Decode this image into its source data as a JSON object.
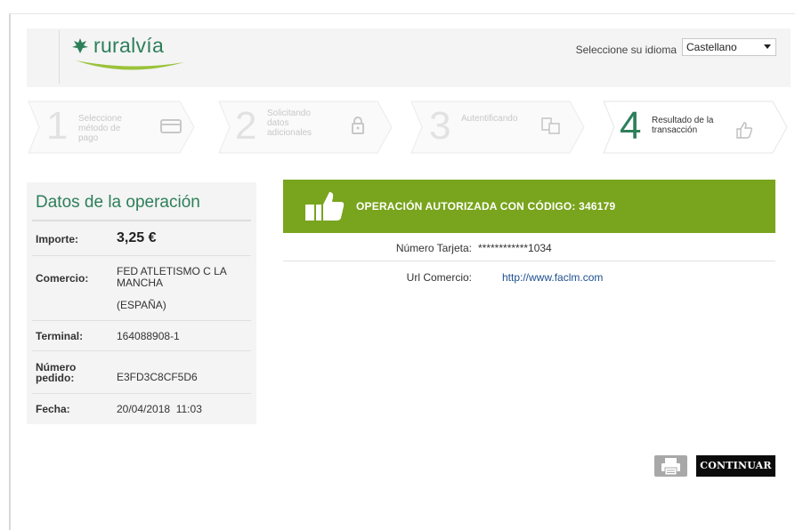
{
  "header": {
    "logo_text": "ruralvía",
    "language_label": "Seleccione su idioma",
    "language_selected": "Castellano"
  },
  "steps": [
    {
      "number": "1",
      "label": "Seleccione método de pago",
      "icon": "credit-card-icon",
      "state": "inactive"
    },
    {
      "number": "2",
      "label": "Solicitando datos adicionales",
      "icon": "lock-icon",
      "state": "inactive"
    },
    {
      "number": "3",
      "label": "Autentificando",
      "icon": "devices-icon",
      "state": "inactive"
    },
    {
      "number": "4",
      "label": "Resultado de la transacción",
      "icon": "thumbs-up-icon",
      "state": "active"
    }
  ],
  "operation": {
    "title": "Datos de la operación",
    "rows": [
      {
        "key": "Importe:",
        "value": "3,25 €"
      },
      {
        "key": "Comercio:",
        "value": "FED ATLETISMO C LA MANCHA",
        "value2": "(ESPAÑA)"
      },
      {
        "key": "Terminal:",
        "value": "164088908-1"
      },
      {
        "key": "Número pedido:",
        "value": "E3FD3C8CF5D6"
      },
      {
        "key": "Fecha:",
        "value": "20/04/2018  11:03"
      }
    ]
  },
  "result": {
    "message": "OPERACIÓN AUTORIZADA CON CÓDIGO: 346179",
    "card_label": "Número Tarjeta:",
    "card_value": "************1034",
    "url_label": "Url Comercio:",
    "url_value": "http://www.faclm.com"
  },
  "actions": {
    "continue_label": "CONTINUAR",
    "print_icon": "printer-icon"
  },
  "colors": {
    "brand_green": "#2d7f5a",
    "banner_green": "#79a41d",
    "link_blue": "#1e4f8f"
  }
}
